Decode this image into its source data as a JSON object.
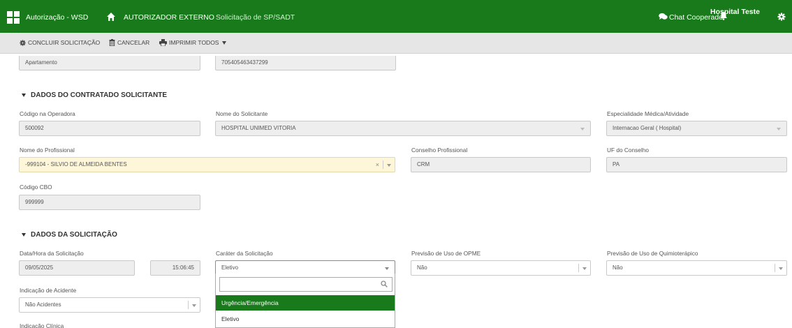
{
  "topbar": {
    "app_title": "Autorização - WSD",
    "section": "AUTORIZADOR EXTERNO",
    "page": "Solicitação de SP/SADT",
    "chat": "Chat Cooperado",
    "hospital": "Hospital Teste"
  },
  "toolbar": {
    "conclude": "CONCLUIR SOLICITAÇÃO",
    "cancel": "CANCELAR",
    "print_all": "IMPRIMIR TODOS"
  },
  "top_fields": {
    "accommodation": "Apartamento",
    "card_number": "705405463437299"
  },
  "contratado": {
    "title": "DADOS DO CONTRATADO SOLICITANTE",
    "codigo_label": "Código na Operadora",
    "codigo_value": "500092",
    "nome_label": "Nome do Solicitante",
    "nome_value": "HOSPITAL UNIMED VITORIA",
    "especialidade_label": "Especialidade Médica/Atividade",
    "especialidade_value": "Internacao Geral ( Hospital)",
    "profissional_label": "Nome do Profissional",
    "profissional_value": "-999104 - SILVIO DE ALMEIDA BENTES",
    "conselho_label": "Conselho Profissional",
    "conselho_value": "CRM",
    "uf_label": "UF do Conselho",
    "uf_value": "PA",
    "cbo_label": "Código CBO",
    "cbo_value": "999999"
  },
  "solicitacao": {
    "title": "DADOS DA SOLICITAÇÃO",
    "data_label": "Data/Hora da Solicitação",
    "date_value": "09/05/2025",
    "time_value": "15:06:45",
    "carater_label": "Caráter da Solicitação",
    "carater_value": "Eletivo",
    "opme_label": "Previsão de Uso de OPME",
    "opme_value": "Não",
    "quimio_label": "Previsão de Uso de Quimioterápico",
    "quimio_value": "Não",
    "acidente_label": "Indicação de Acidente",
    "acidente_value": "Não Acidentes",
    "clinica_label": "Indicação Clínica",
    "dropdown_options": [
      "Urgência/Emergência",
      "Eletivo"
    ]
  },
  "colors": {
    "brand": "#187a1a",
    "toolbar": "#e6e6e6"
  }
}
